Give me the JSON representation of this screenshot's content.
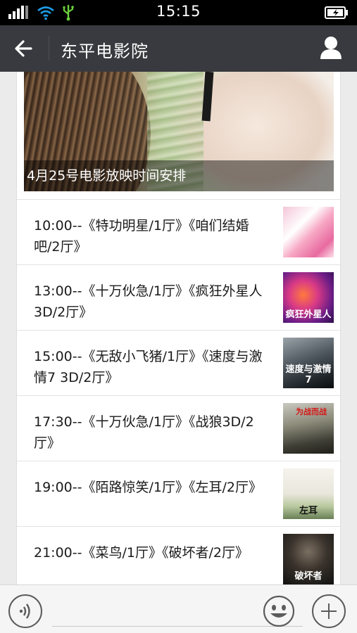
{
  "status_bar": {
    "time": "15:15"
  },
  "header": {
    "title": "东平电影院"
  },
  "banner": {
    "caption": "4月25号电影放映时间安排"
  },
  "schedule": [
    {
      "text": "10:00--《特功明星/1厅》《咱们结婚吧/2厅》"
    },
    {
      "text": "13:00--《十万伙急/1厅》《疯狂外星人3D/2厅》"
    },
    {
      "text": "15:00--《无敌小飞猪/1厅》《速度与激情7 3D/2厅》"
    },
    {
      "text": "17:30--《十万伙急/1厅》《战狼3D/2厅》"
    },
    {
      "text": "19:00--《陌路惊笑/1厅》《左耳/2厅》"
    },
    {
      "text": "21:00--《菜鸟/1厅》《破坏者/2厅》"
    }
  ],
  "thumbnails": [
    {
      "label": ""
    },
    {
      "label": "疯狂外星人"
    },
    {
      "label": "速度与激情7"
    },
    {
      "label": "",
      "top_text": "为战而战"
    },
    {
      "label": "左耳"
    },
    {
      "label": "破坏者"
    }
  ],
  "colors": {
    "header_bg": "#393a3f",
    "status_bg": "#000000"
  },
  "icons": [
    "signal-icon",
    "wifi-icon",
    "usb-icon",
    "battery-icon",
    "back-arrow-icon",
    "profile-icon",
    "voice-icon",
    "emoji-icon",
    "plus-icon"
  ]
}
